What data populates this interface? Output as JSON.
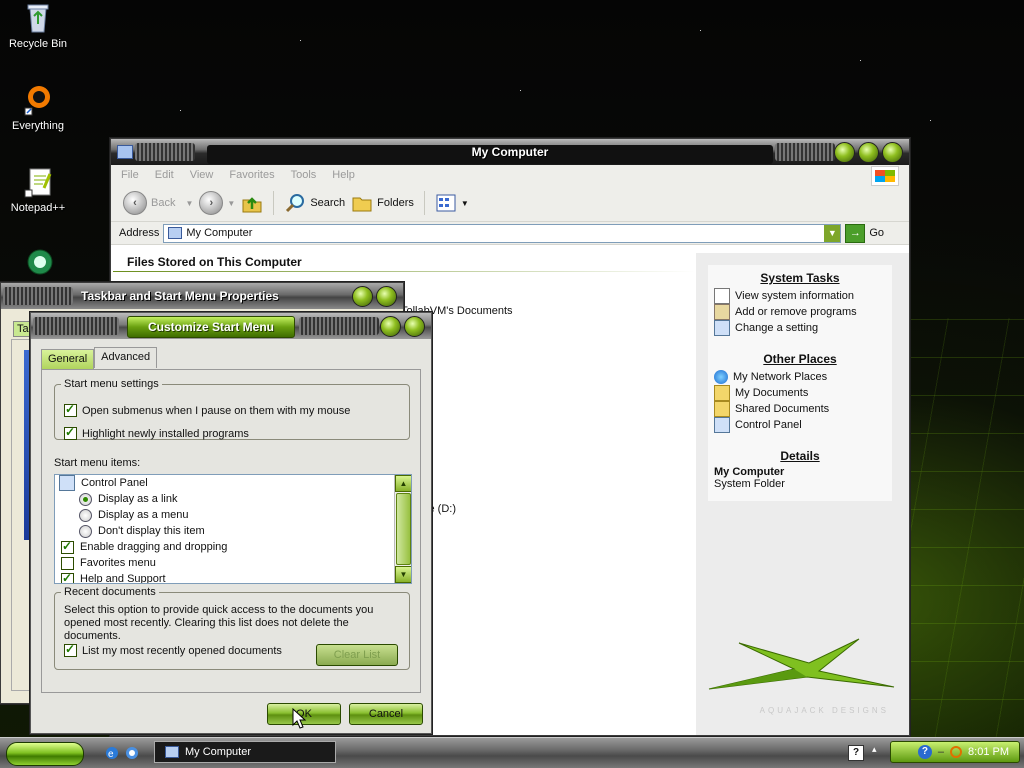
{
  "desktop": {
    "icons": [
      {
        "label": "Recycle Bin",
        "icon": "recycle-bin-icon"
      },
      {
        "label": "Everything",
        "icon": "everything-icon"
      },
      {
        "label": "Notepad++",
        "icon": "notepad-plus-plus-icon"
      }
    ]
  },
  "my_computer": {
    "title": "My Computer",
    "menu": [
      "File",
      "Edit",
      "View",
      "Favorites",
      "Tools",
      "Help"
    ],
    "toolbar": {
      "back": "Back",
      "search": "Search",
      "folders": "Folders"
    },
    "address": {
      "label": "Address",
      "value": "My Computer",
      "go": "Go"
    },
    "files_header": "Files Stored on This Computer",
    "file_partial_1": "TollabVM's Documents",
    "file_partial_2": "ve (D:)",
    "system_tasks": {
      "title": "System Tasks",
      "items": [
        "View system information",
        "Add or remove programs",
        "Change a setting"
      ]
    },
    "other_places": {
      "title": "Other Places",
      "items": [
        "My Network Places",
        "My Documents",
        "Shared Documents",
        "Control Panel"
      ]
    },
    "details": {
      "title": "Details",
      "name": "My Computer",
      "type": "System Folder"
    },
    "logo_text": "AQUAJACK DESIGNS"
  },
  "taskbar_props": {
    "title": "Taskbar and Start Menu Properties",
    "tab_partial": "Ta"
  },
  "customize": {
    "title": "Customize Start Menu",
    "tabs": [
      "General",
      "Advanced"
    ],
    "start_menu_settings": {
      "legend": "Start menu settings",
      "open_submenus": "Open submenus when I pause on them with my mouse",
      "highlight_new": "Highlight newly installed programs"
    },
    "items_label": "Start menu items:",
    "items": {
      "control_panel": "Control Panel",
      "display_link": "Display as a link",
      "display_menu": "Display as a menu",
      "dont_display": "Don't display this item",
      "enable_drag": "Enable dragging and dropping",
      "favorites": "Favorites menu",
      "help": "Help and Support"
    },
    "recent_docs": {
      "legend": "Recent documents",
      "description": "Select this option to provide quick access to the documents you opened most recently.  Clearing this list does not delete the documents.",
      "list_recent": "List my most recently opened documents",
      "clear_list": "Clear List"
    },
    "ok": "OK",
    "cancel": "Cancel"
  },
  "taskbar": {
    "task_label": "My Computer",
    "clock": "8:01 PM"
  },
  "colors": {
    "accent_green": "#7fc020",
    "dark_chrome": "#3e3e3e"
  }
}
